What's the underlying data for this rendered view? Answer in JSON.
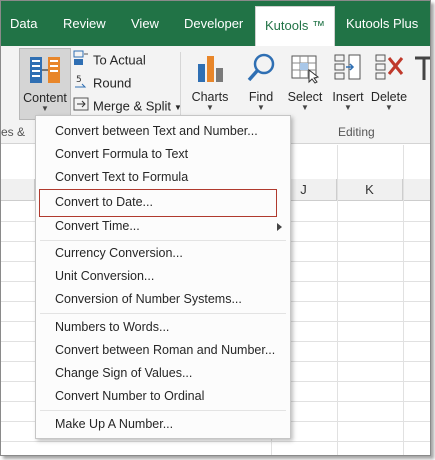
{
  "tabs": [
    {
      "label": "Data"
    },
    {
      "label": "Review"
    },
    {
      "label": "View"
    },
    {
      "label": "Developer"
    },
    {
      "label": "Kutools ™"
    },
    {
      "label": "Kutools Plus"
    }
  ],
  "ribbon": {
    "content_label": "Content",
    "to_actual_label": "To Actual",
    "round_label": "Round",
    "merge_split_label": "Merge & Split",
    "charts_label": "Charts",
    "find_label": "Find",
    "select_label": "Select",
    "insert_label": "Insert",
    "delete_label": "Delete",
    "group_left_partial": "es &",
    "group_editing": "Editing"
  },
  "columns": {
    "j": "J",
    "k": "K"
  },
  "menu": {
    "items": [
      {
        "label": "Convert between Text and Number..."
      },
      {
        "label": "Convert Formula to Text"
      },
      {
        "label": "Convert Text to Formula"
      },
      {
        "label": "Convert to Date..."
      },
      {
        "label": "Convert Time..."
      },
      {
        "label": "Currency Conversion..."
      },
      {
        "label": "Unit Conversion..."
      },
      {
        "label": "Conversion of Number Systems..."
      },
      {
        "label": "Numbers to Words..."
      },
      {
        "label": "Convert between Roman and Number..."
      },
      {
        "label": "Change Sign of Values..."
      },
      {
        "label": "Convert Number to Ordinal"
      },
      {
        "label": "Make Up A Number..."
      }
    ]
  },
  "colors": {
    "ribbon_green": "#217346",
    "highlight_border": "#b03a2e"
  }
}
